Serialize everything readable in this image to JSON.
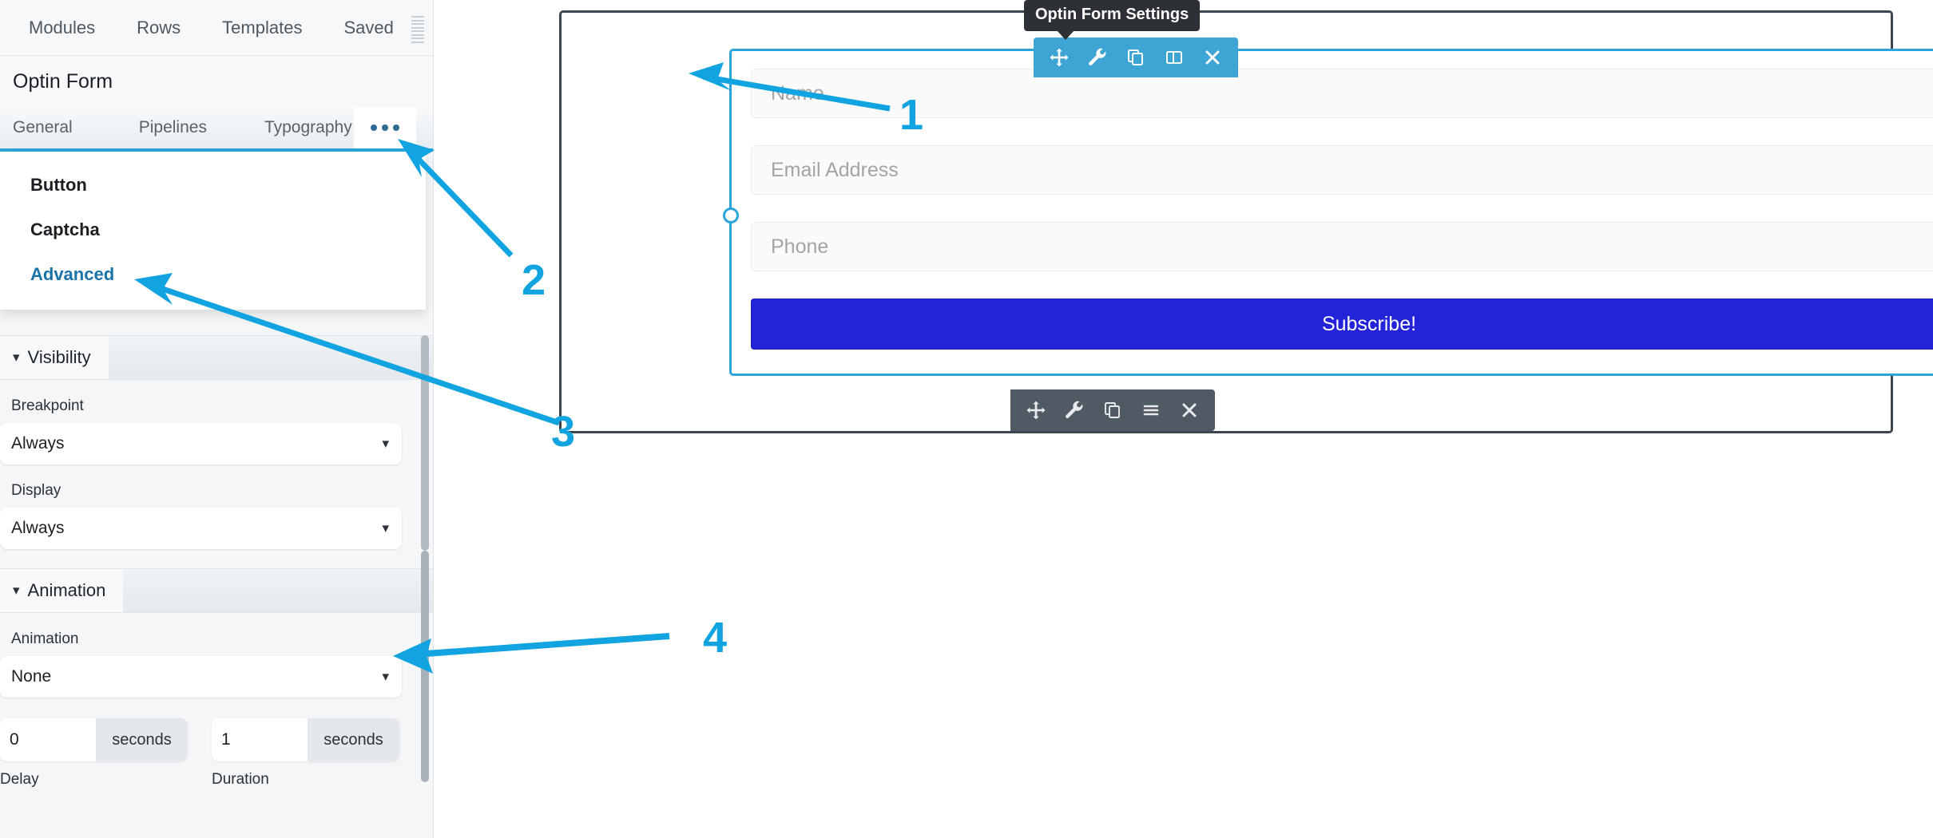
{
  "panel": {
    "nav": {
      "items": [
        {
          "label": "Modules"
        },
        {
          "label": "Rows"
        },
        {
          "label": "Templates"
        },
        {
          "label": "Saved"
        }
      ]
    },
    "title": "Optin Form",
    "tabs": [
      {
        "label": "General"
      },
      {
        "label": "Pipelines"
      },
      {
        "label": "Typography"
      }
    ],
    "more_tab": "•••",
    "dropdown": {
      "items": [
        {
          "label": "Button",
          "active": false
        },
        {
          "label": "Captcha",
          "active": false
        },
        {
          "label": "Advanced",
          "active": true
        }
      ]
    },
    "sections": {
      "visibility": {
        "heading": "Visibility",
        "breakpoint_label": "Breakpoint",
        "breakpoint_value": "Always",
        "display_label": "Display",
        "display_value": "Always"
      },
      "animation": {
        "heading": "Animation",
        "animation_label": "Animation",
        "animation_value": "None",
        "delay_value": "0",
        "delay_unit": "seconds",
        "delay_label": "Delay",
        "duration_value": "1",
        "duration_unit": "seconds",
        "duration_label": "Duration"
      }
    }
  },
  "canvas": {
    "tooltip": "Optin Form Settings",
    "module_toolbar": [
      {
        "icon": "move-icon"
      },
      {
        "icon": "wrench-icon"
      },
      {
        "icon": "duplicate-icon"
      },
      {
        "icon": "columns-icon"
      },
      {
        "icon": "close-icon"
      }
    ],
    "row_toolbar": [
      {
        "icon": "move-icon"
      },
      {
        "icon": "wrench-icon"
      },
      {
        "icon": "duplicate-icon"
      },
      {
        "icon": "menu-icon"
      },
      {
        "icon": "close-icon"
      }
    ],
    "form": {
      "fields": [
        {
          "placeholder": "Name"
        },
        {
          "placeholder": "Email Address"
        },
        {
          "placeholder": "Phone"
        }
      ],
      "submit_label": "Subscribe!"
    }
  },
  "annotations": [
    {
      "number": "1"
    },
    {
      "number": "2"
    },
    {
      "number": "3"
    },
    {
      "number": "4"
    }
  ],
  "colors": {
    "accent_blue": "#12a4e0",
    "toolbar_blue": "#3ea4d4",
    "toolbar_dark": "#505a64",
    "submit_blue": "#2323d9",
    "link_blue": "#1a73a8"
  }
}
